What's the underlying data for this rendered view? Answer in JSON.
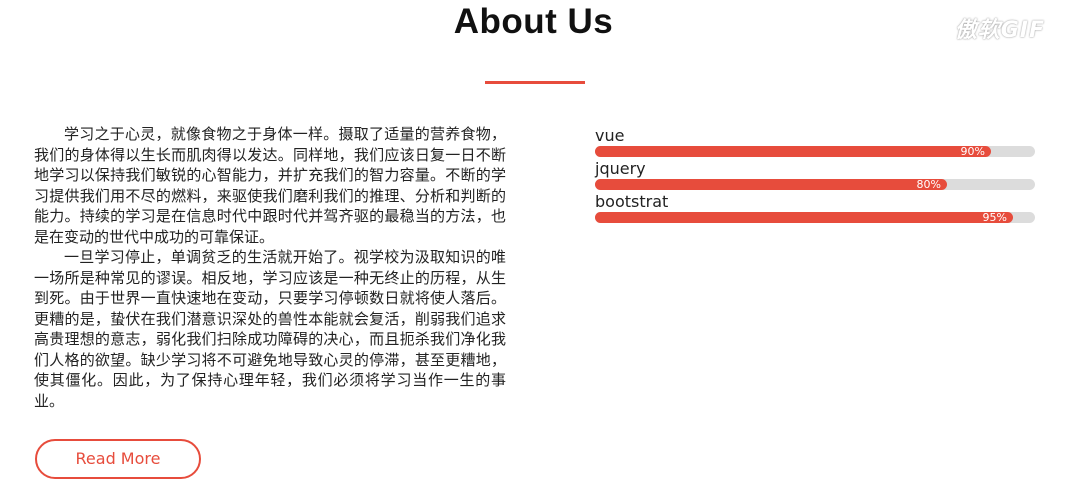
{
  "header": {
    "title": "About Us",
    "watermark": "傲软GIF"
  },
  "intro": {
    "paragraphs": [
      "学习之于心灵，就像食物之于身体一样。摄取了适量的营养食物，我们的身体得以生长而肌肉得以发达。同样地，我们应该日复一日不断地学习以保持我们敏锐的心智能力，并扩充我们的智力容量。不断的学习提供我们用不尽的燃料，来驱使我们磨利我们的推理、分析和判断的能力。持续的学习是在信息时代中跟时代并驾齐驱的最稳当的方法，也是在变动的世代中成功的可靠保证。",
      "一旦学习停止，单调贫乏的生活就开始了。视学校为汲取知识的唯一场所是种常见的谬误。相反地，学习应该是一种无终止的历程，从生到死。由于世界一直快速地在变动，只要学习停顿数日就将使人落后。更糟的是，蛰伏在我们潜意识深处的兽性本能就会复活，削弱我们追求高贵理想的意志，弱化我们扫除成功障碍的决心，而且扼杀我们净化我们人格的欲望。缺少学习将不可避免地导致心灵的停滞，甚至更糟地，使其僵化。因此，为了保持心理年轻，我们必须将学习当作一生的事业。"
    ],
    "read_more_label": "Read More"
  },
  "skills": [
    {
      "name": "vue",
      "percent": 90,
      "percent_label": "90%"
    },
    {
      "name": "jquery",
      "percent": 80,
      "percent_label": "80%"
    },
    {
      "name": "bootstrat",
      "percent": 95,
      "percent_label": "95%"
    }
  ],
  "colors": {
    "accent": "#e74c3c",
    "track": "#dcdcdc"
  }
}
